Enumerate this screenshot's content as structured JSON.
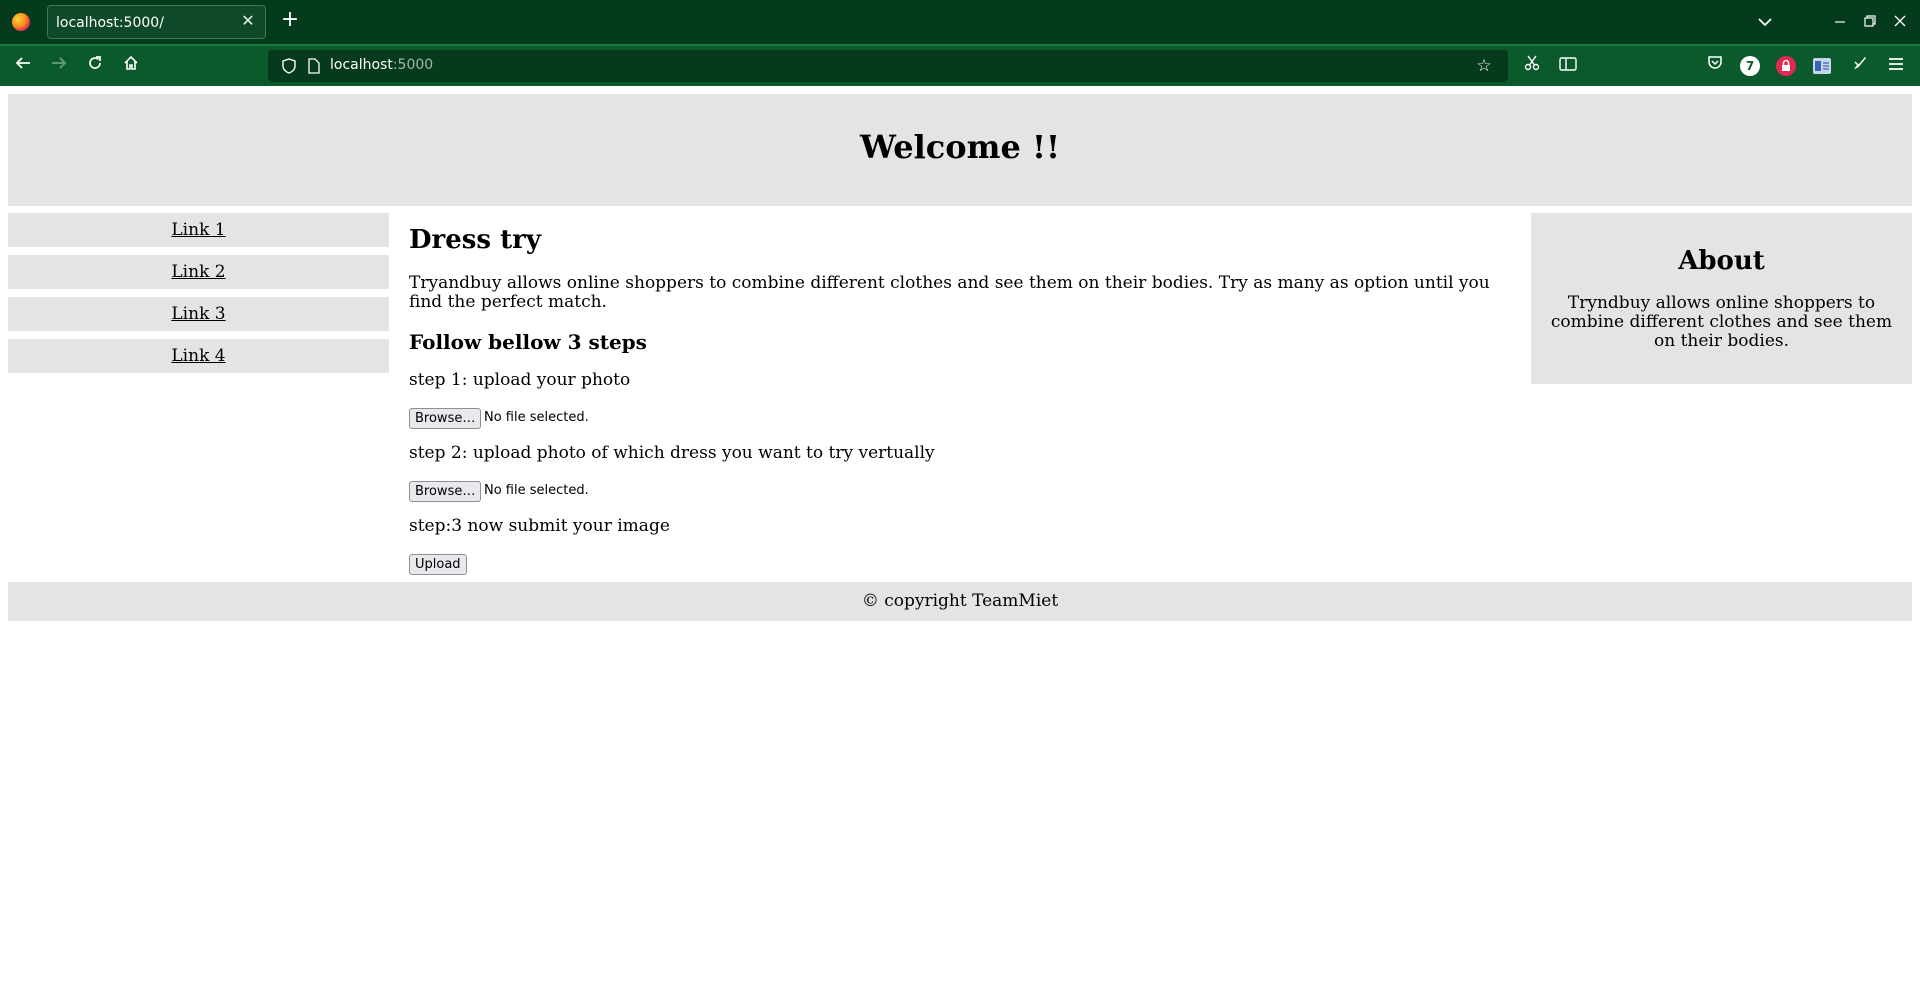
{
  "browser": {
    "tab_title": "localhost:5000/",
    "url_host": "localhost",
    "url_port": ":5000",
    "colors": {
      "tabbar": "#053b1d",
      "toolbar": "#0b5a2b",
      "urlbar": "#053a1c"
    }
  },
  "page": {
    "header_title": "Welcome !!",
    "nav_links": [
      "Link 1",
      "Link 2",
      "Link 3",
      "Link 4"
    ],
    "main": {
      "title": "Dress try",
      "intro": "Tryandbuy allows online shoppers to combine different clothes and see them on their bodies. Try as many as option until you find the perfect match.",
      "subtitle": "Follow bellow 3 steps",
      "step1": "step 1: upload your photo",
      "step2": "step 2: upload photo of which dress you want to try vertually",
      "step3": "step:3 now submit your image",
      "browse_label": "Browse…",
      "no_file_label": "No file selected.",
      "upload_label": "Upload"
    },
    "about": {
      "title": "About",
      "text": "Tryndbuy allows online shoppers to combine different clothes and see them on their bodies."
    },
    "footer": "© copyright TeamMiet"
  }
}
